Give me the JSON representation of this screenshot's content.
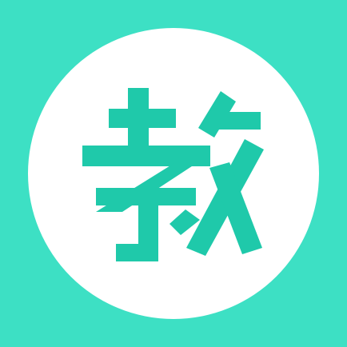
{
  "icon": {
    "name": "jiao-app-icon",
    "character": "教",
    "colors": {
      "background": "#3de0c4",
      "disc": "#ffffff",
      "glyph": "#1fc9aa"
    }
  }
}
